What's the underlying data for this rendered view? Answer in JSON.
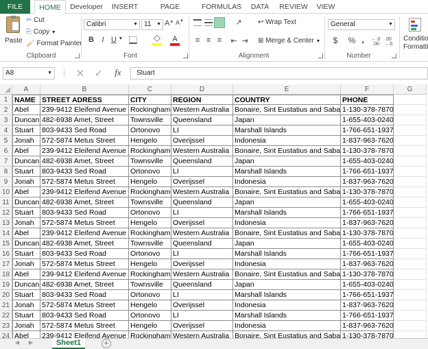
{
  "ribbon_tabs": [
    "FILE",
    "HOME",
    "Developer",
    "INSERT",
    "PAGE LAYOUT",
    "FORMULAS",
    "DATA",
    "REVIEW",
    "VIEW"
  ],
  "clipboard": {
    "paste": "Paste",
    "cut": "Cut",
    "copy": "Copy",
    "format_painter": "Format Painter",
    "group": "Clipboard"
  },
  "font": {
    "name": "Calibri",
    "size": "11",
    "group": "Font",
    "bold": "B",
    "italic": "I",
    "underline": "U"
  },
  "alignment": {
    "wrap_text": "Wrap Text",
    "merge_center": "Merge & Center",
    "group": "Alignment"
  },
  "number": {
    "format": "General",
    "currency": "$",
    "percent": "%",
    "comma": ",",
    "group": "Number"
  },
  "styles": {
    "conditional": "Conditional",
    "formatting": "Formatting"
  },
  "formula_bar": {
    "name_box": "A8",
    "fx": "fx",
    "value": "Stuart"
  },
  "columns": [
    "A",
    "B",
    "C",
    "D",
    "E",
    "F",
    "G"
  ],
  "rows": [
    [
      "NAME",
      "STREET ADRESS",
      "CITY",
      "REGION",
      "COUNTRY",
      "PHONE"
    ],
    [
      "Abel",
      "239-9412 Eleifend Avenue",
      "Rockingham",
      "Western Australia",
      "Bonaire, Sint Eustatius and Saba",
      "1-130-378-7870"
    ],
    [
      "Duncan",
      "482-6938 Amet, Street",
      "Townsville",
      "Queensland",
      "Japan",
      "1-655-403-0240"
    ],
    [
      "Stuart",
      "803-9433 Sed Road",
      "Ortonovo",
      "LI",
      "Marshall Islands",
      "1-766-651-1937"
    ],
    [
      "Jonah",
      "572-5874 Metus Street",
      "Hengelo",
      "Overijssel",
      "Indonesia",
      "1-837-963-7620"
    ],
    [
      "Abel",
      "239-9412 Eleifend Avenue",
      "Rockingham",
      "Western Australia",
      "Bonaire, Sint Eustatius and Saba",
      "1-130-378-7870"
    ],
    [
      "Duncan",
      "482-6938 Amet, Street",
      "Townsville",
      "Queensland",
      "Japan",
      "1-655-403-0240"
    ],
    [
      "Stuart",
      "803-9433 Sed Road",
      "Ortonovo",
      "LI",
      "Marshall Islands",
      "1-766-651-1937"
    ],
    [
      "Jonah",
      "572-5874 Metus Street",
      "Hengelo",
      "Overijssel",
      "Indonesia",
      "1-837-963-7620"
    ],
    [
      "Abel",
      "239-9412 Eleifend Avenue",
      "Rockingham",
      "Western Australia",
      "Bonaire, Sint Eustatius and Saba",
      "1-130-378-7870"
    ],
    [
      "Duncan",
      "482-6938 Amet, Street",
      "Townsville",
      "Queensland",
      "Japan",
      "1-655-403-0240"
    ],
    [
      "Stuart",
      "803-9433 Sed Road",
      "Ortonovo",
      "LI",
      "Marshall Islands",
      "1-766-651-1937"
    ],
    [
      "Jonah",
      "572-5874 Metus Street",
      "Hengelo",
      "Overijssel",
      "Indonesia",
      "1-837-963-7620"
    ],
    [
      "Abel",
      "239-9412 Eleifend Avenue",
      "Rockingham",
      "Western Australia",
      "Bonaire, Sint Eustatius and Saba",
      "1-130-378-7870"
    ],
    [
      "Duncan",
      "482-6938 Amet, Street",
      "Townsville",
      "Queensland",
      "Japan",
      "1-655-403-0240"
    ],
    [
      "Stuart",
      "803-9433 Sed Road",
      "Ortonovo",
      "LI",
      "Marshall Islands",
      "1-766-651-1937"
    ],
    [
      "Jonah",
      "572-5874 Metus Street",
      "Hengelo",
      "Overijssel",
      "Indonesia",
      "1-837-963-7620"
    ],
    [
      "Abel",
      "239-9412 Eleifend Avenue",
      "Rockingham",
      "Western Australia",
      "Bonaire, Sint Eustatius and Saba",
      "1-130-378-7870"
    ],
    [
      "Duncan",
      "482-6938 Amet, Street",
      "Townsville",
      "Queensland",
      "Japan",
      "1-655-403-0240"
    ],
    [
      "Stuart",
      "803-9433 Sed Road",
      "Ortonovo",
      "LI",
      "Marshall Islands",
      "1-766-651-1937"
    ],
    [
      "Jonah",
      "572-5874 Metus Street",
      "Hengelo",
      "Overijssel",
      "Indonesia",
      "1-837-963-7620"
    ],
    [
      "Stuart",
      "803-9433 Sed Road",
      "Ortonovo",
      "LI",
      "Marshall Islands",
      "1-766-651-1937"
    ],
    [
      "Jonah",
      "572-5874 Metus Street",
      "Hengelo",
      "Overijssel",
      "Indonesia",
      "1-837-963-7620"
    ],
    [
      "Abel",
      "239-9412 Eleifend Avenue",
      "Rockingham",
      "Western Australia",
      "Bonaire, Sint Eustatius and Saba",
      "1-130-378-7870"
    ]
  ],
  "sheet_tab": "Sheet1",
  "colors": {
    "accent": "#217346"
  }
}
